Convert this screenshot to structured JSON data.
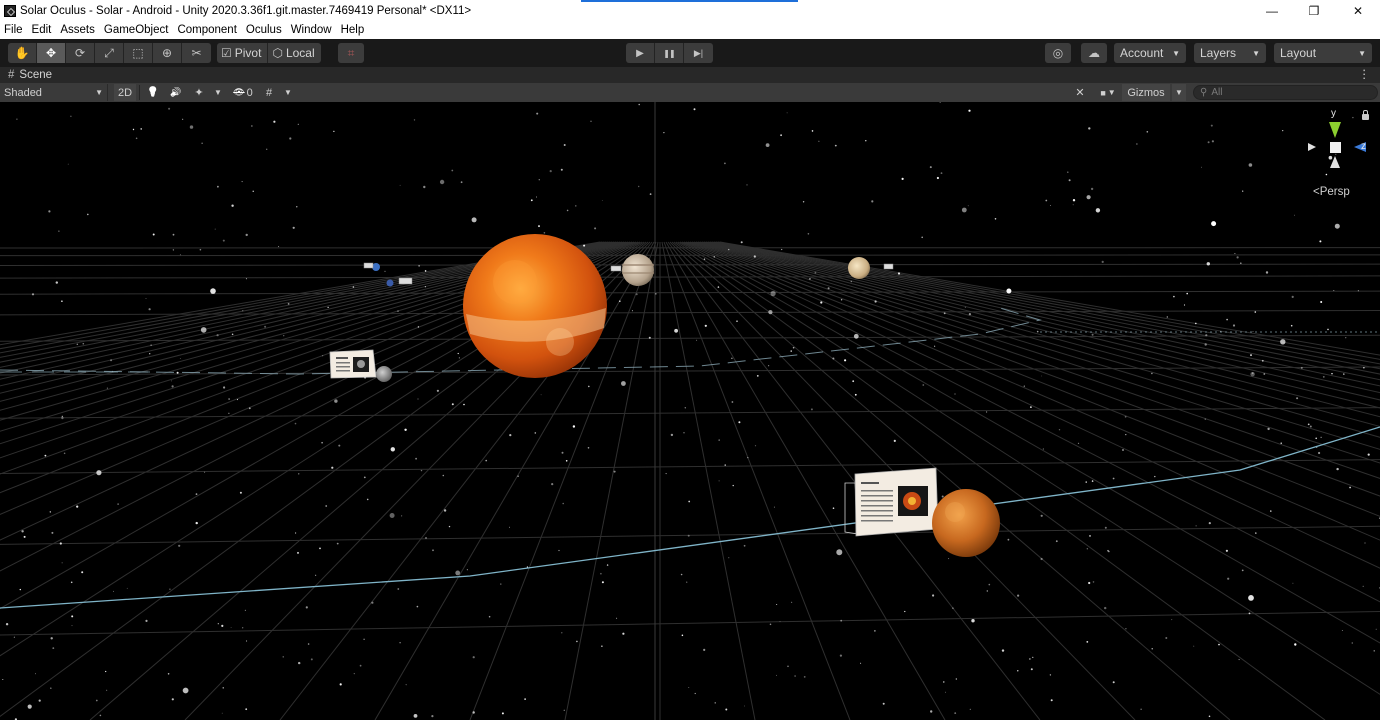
{
  "window": {
    "title": "Solar Oculus - Solar - Android - Unity 2020.3.36f1.git.master.7469419 Personal* <DX11>",
    "minimize_glyph": "—",
    "maximize_glyph": "❐",
    "close_glyph": "✕"
  },
  "menu": {
    "items": [
      "File",
      "Edit",
      "Assets",
      "GameObject",
      "Component",
      "Oculus",
      "Window",
      "Help"
    ]
  },
  "toolbar": {
    "tools": [
      {
        "icon": "hand-icon",
        "glyph": "✋",
        "active": false
      },
      {
        "icon": "move-icon",
        "glyph": "✥",
        "active": true
      },
      {
        "icon": "rotate-icon",
        "glyph": "⟳",
        "active": false
      },
      {
        "icon": "scale-icon",
        "glyph": "⤢",
        "active": false
      },
      {
        "icon": "rect-icon",
        "glyph": "⬚",
        "active": false
      },
      {
        "icon": "transform-icon",
        "glyph": "⊕",
        "active": false
      },
      {
        "icon": "custom-tool-icon",
        "glyph": "✂",
        "active": false
      }
    ],
    "pivot_label": "Pivot",
    "local_label": "Local",
    "snap_glyph": "⌗",
    "play_glyph": "▶",
    "pause_glyph": "❚❚",
    "step_glyph": "▶|",
    "collab_glyph": "◎",
    "cloud_glyph": "☁",
    "account_label": "Account",
    "layers_label": "Layers",
    "layout_label": "Layout"
  },
  "scene_tab": {
    "label": "Scene",
    "hash_glyph": "#",
    "menu_glyph": "⋮"
  },
  "scene_toolbar": {
    "shading": "Shaded",
    "mode_2d": "2D",
    "light_glyph": "💡",
    "audio_glyph": "🔊",
    "effects_glyph": "✦",
    "hidden_count": "0",
    "hidden_glyph": "👁",
    "grid_glyph": "#",
    "tools_glyph": "✕",
    "camera_glyph": "■",
    "gizmos_label": "Gizmos",
    "search_glyph": "⚲",
    "search_placeholder": "All"
  },
  "scene_view": {
    "projection_label": "<Persp",
    "gizmo_axes": {
      "y": "y",
      "z": "z"
    }
  }
}
